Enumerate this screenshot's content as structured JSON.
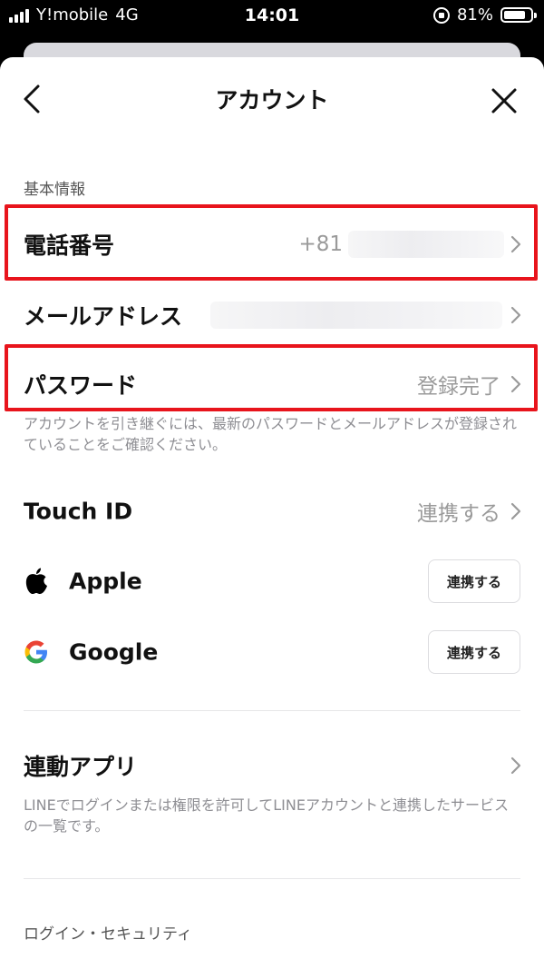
{
  "status_bar": {
    "carrier": "Y!mobile",
    "network": "4G",
    "time": "14:01",
    "battery": "81%",
    "battery_level": 0.81
  },
  "nav": {
    "title": "アカウント",
    "back_icon": "chevron-left-icon",
    "close_icon": "close-icon"
  },
  "basic_info": {
    "header": "基本情報",
    "phone": {
      "label": "電話番号",
      "value": "+81"
    },
    "email": {
      "label": "メールアドレス"
    },
    "password": {
      "label": "パスワード",
      "value": "登録完了"
    },
    "note": "アカウントを引き継ぐには、最新のパスワードとメールアドレスが登録されていることをご確認ください。"
  },
  "touch_id": {
    "label": "Touch ID",
    "value": "連携する"
  },
  "apple": {
    "label": "Apple",
    "button": "連携する",
    "icon": "apple-logo-icon"
  },
  "google": {
    "label": "Google",
    "button": "連携する",
    "icon": "google-logo-icon"
  },
  "linked_apps": {
    "label": "連動アプリ",
    "note": "LINEでログインまたは権限を許可してLINEアカウントと連携したサービスの一覧です。"
  },
  "login_security": {
    "header": "ログイン・セキュリティ"
  },
  "colors": {
    "highlight": "#e8141c",
    "muted": "#9a9a9a",
    "google_blue": "#4285F4",
    "google_red": "#EA4335",
    "google_yellow": "#FBBC05",
    "google_green": "#34A853"
  }
}
